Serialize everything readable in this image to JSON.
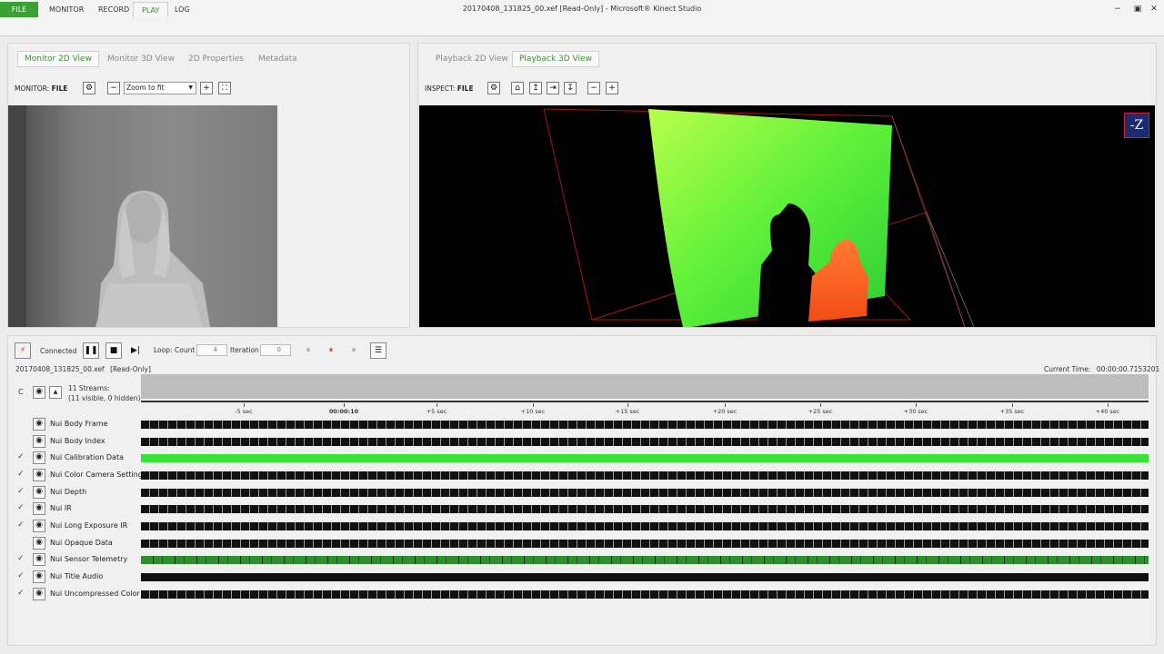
{
  "window": {
    "title": "20170408_131825_00.xef [Read-Only] - Microsoft® Kinect Studio",
    "minimize": "−",
    "maximize": "▣",
    "close": "✕"
  },
  "menu": [
    "FILE",
    "MONITOR",
    "RECORD",
    "PLAY",
    "LOG"
  ],
  "active_menu": "PLAY",
  "left_panel": {
    "tabs": [
      "Monitor 2D View",
      "Monitor 3D View",
      "2D Properties",
      "Metadata"
    ],
    "active_tab": "Monitor 2D View",
    "toolbar_label": "MONITOR:",
    "toolbar_value": "FILE",
    "zoom": "Zoom to fit"
  },
  "right_panel": {
    "tabs": [
      "Playback 2D View",
      "Playback 3D View"
    ],
    "active_tab": "Playback 3D View",
    "toolbar_label": "INSPECT:",
    "toolbar_value": "FILE",
    "orientation_badge": "-Z"
  },
  "playback": {
    "status": "Connected",
    "loop_label": "Loop:",
    "count_label": "Count",
    "count_value": "4",
    "iteration_label": "Iteration",
    "iteration_value": "0",
    "file_name": "20170408_131825_00.xef",
    "read_only": "[Read-Only]",
    "current_time_label": "Current Time:",
    "current_time_value": "00:00:00.7153201",
    "streams_count": "11 Streams:",
    "streams_detail": "(11 visible, 0 hidden)",
    "collapse_label": "C"
  },
  "timeline_ticks": [
    "-5 sec",
    "00:00:10",
    "+5 sec",
    "+10 sec",
    "+15 sec",
    "+20 sec",
    "+25 sec",
    "+30 sec",
    "+35 sec",
    "+40 sec"
  ],
  "streams": [
    {
      "name": "Nui Body Frame",
      "checked": false,
      "style": "dark"
    },
    {
      "name": "Nui Body Index",
      "checked": false,
      "style": "dark"
    },
    {
      "name": "Nui Calibration Data",
      "checked": true,
      "style": "green"
    },
    {
      "name": "Nui Color Camera Settings",
      "checked": true,
      "style": "dark"
    },
    {
      "name": "Nui Depth",
      "checked": true,
      "style": "dark"
    },
    {
      "name": "Nui IR",
      "checked": true,
      "style": "dark"
    },
    {
      "name": "Nui Long Exposure IR",
      "checked": true,
      "style": "dark"
    },
    {
      "name": "Nui Opaque Data",
      "checked": false,
      "style": "dark"
    },
    {
      "name": "Nui Sensor Telemetry",
      "checked": true,
      "style": "telemetry"
    },
    {
      "name": "Nui Title Audio",
      "checked": true,
      "style": "audio"
    },
    {
      "name": "Nui Uncompressed Color",
      "checked": true,
      "style": "dark"
    }
  ],
  "colors": {
    "accent": "#3c8e36",
    "file_menu": "#3aa235",
    "calibration": "#39e139",
    "telemetry": "#2f8f2f"
  }
}
